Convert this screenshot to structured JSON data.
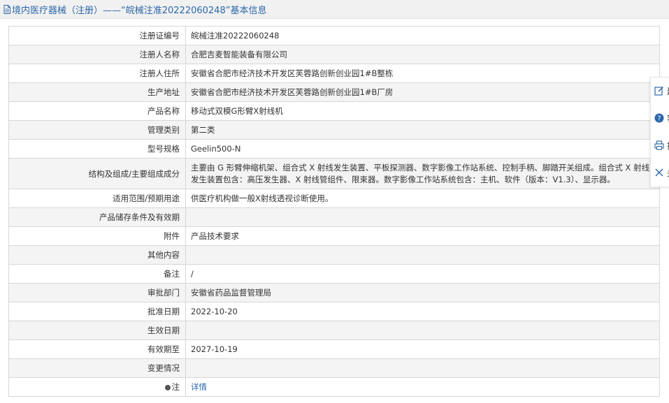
{
  "header": {
    "title": "境内医疗器械（注册）——“皖械注准20222060248”基本信息"
  },
  "rows": [
    {
      "label": "注册证编号",
      "value": "皖械注准20222060248"
    },
    {
      "label": "注册人名称",
      "value": "合肥吉麦智能装备有限公司"
    },
    {
      "label": "注册人住所",
      "value": "安徽省合肥市经济技术开发区芙蓉路创新创业园1#B整栋"
    },
    {
      "label": "生产地址",
      "value": "安徽省合肥市经济技术开发区芙蓉路创新创业园1#B厂房"
    },
    {
      "label": "产品名称",
      "value": "移动式双模G形臂X射线机"
    },
    {
      "label": "管理类别",
      "value": "第二类"
    },
    {
      "label": "型号规格",
      "value": "Geelin500-N"
    },
    {
      "label": "结构及组成/主要组成成分",
      "value": "主要由 G 形臂伸缩机架、组合式 X 射线发生装置、平板探测器、数字影像工作站系统、控制手柄、脚踏开关组成。组合式 X 射线发生装置包含：高压发生器、X 射线管组件、限束器。数字影像工作站系统包含：主机、软件（版本：V1.3）、显示器。"
    },
    {
      "label": "适用范围/预期用途",
      "value": "供医疗机构做一般X射线透视诊断使用。"
    },
    {
      "label": "产品储存条件及有效期",
      "value": ""
    },
    {
      "label": "附件",
      "value": "产品技术要求"
    },
    {
      "label": "其他内容",
      "value": ""
    },
    {
      "label": "备注",
      "value": "/"
    },
    {
      "label": "审批部门",
      "value": "安徽省药品监督管理局"
    },
    {
      "label": "批准日期",
      "value": "2022-10-20"
    },
    {
      "label": "生效日期",
      "value": ""
    },
    {
      "label": "有效期至",
      "value": "2027-10-19"
    },
    {
      "label": "变更情况",
      "value": ""
    },
    {
      "label": "注",
      "value": "详情"
    }
  ],
  "sidebar": {
    "items": [
      {
        "icon": "edit-icon",
        "label": "建"
      },
      {
        "icon": "question-icon",
        "label": "客"
      },
      {
        "icon": "print-icon",
        "label": "打"
      },
      {
        "icon": "close-icon",
        "label": "关"
      }
    ]
  },
  "colors": {
    "link": "#2b67a8",
    "row_alt": "#f4f4f4",
    "border": "#d7d7d7"
  }
}
